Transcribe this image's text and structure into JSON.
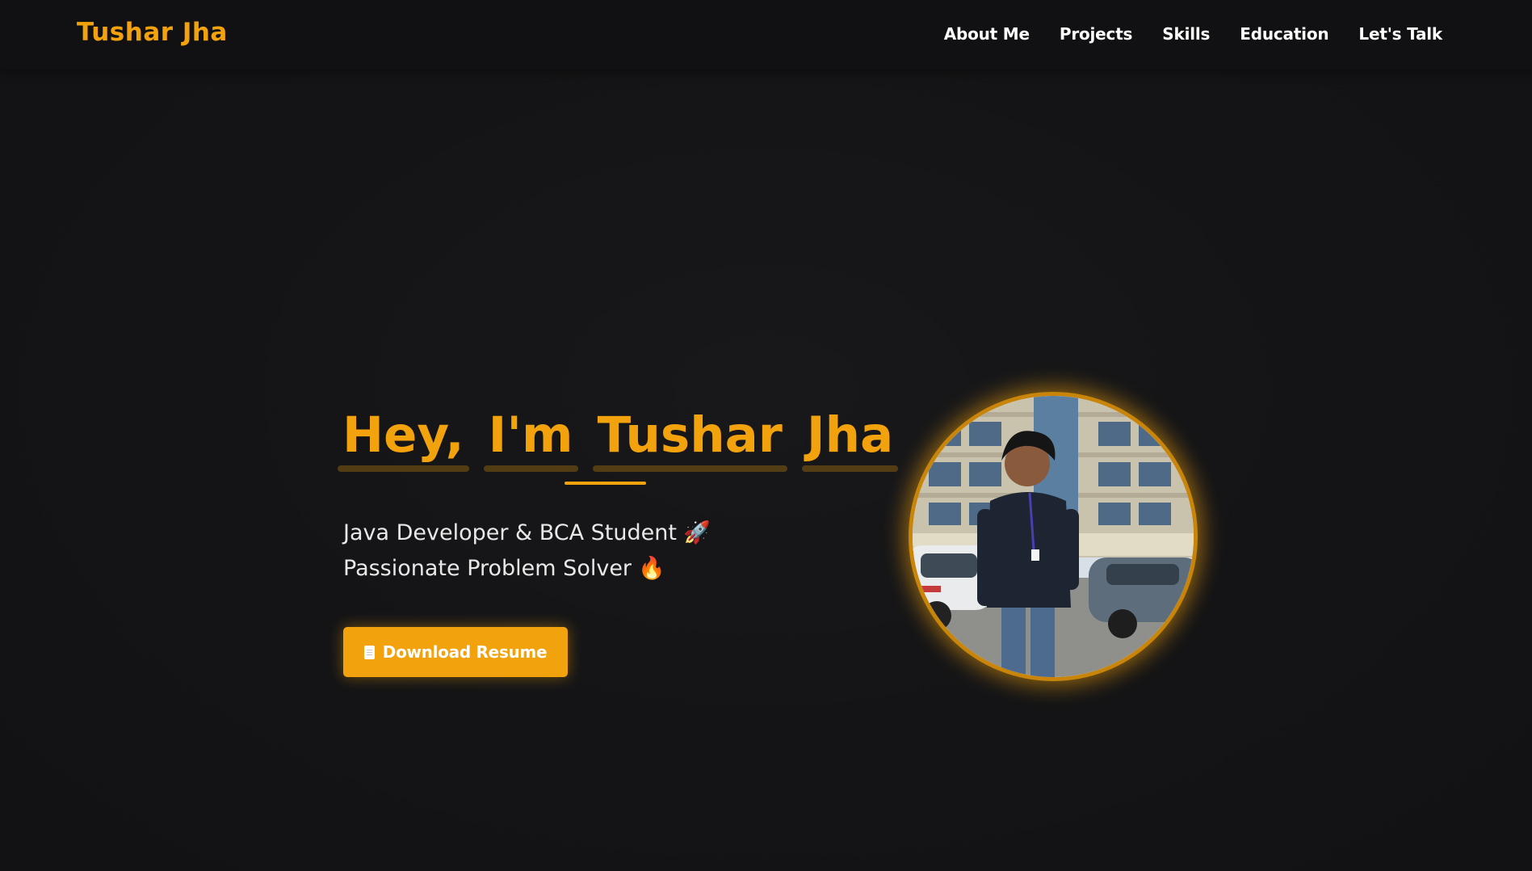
{
  "brand": "Tushar Jha",
  "nav": {
    "items": [
      {
        "label": "About Me"
      },
      {
        "label": "Projects"
      },
      {
        "label": "Skills"
      },
      {
        "label": "Education"
      },
      {
        "label": "Let's Talk"
      }
    ]
  },
  "hero": {
    "title_words": [
      "Hey,",
      "I'm",
      "Tushar",
      "Jha"
    ],
    "subtitle_line1": "Java Developer & BCA Student",
    "subtitle_line1_emoji": "🚀",
    "subtitle_line2": "Passionate Problem Solver",
    "subtitle_line2_emoji": "🔥",
    "download_label": "Download Resume",
    "download_icon": "document-icon"
  },
  "colors": {
    "accent": "#f2a20c",
    "background": "#141416",
    "navbar": "#111113",
    "text": "#ffffff"
  },
  "avatar": {
    "icon": "profile-photo"
  }
}
